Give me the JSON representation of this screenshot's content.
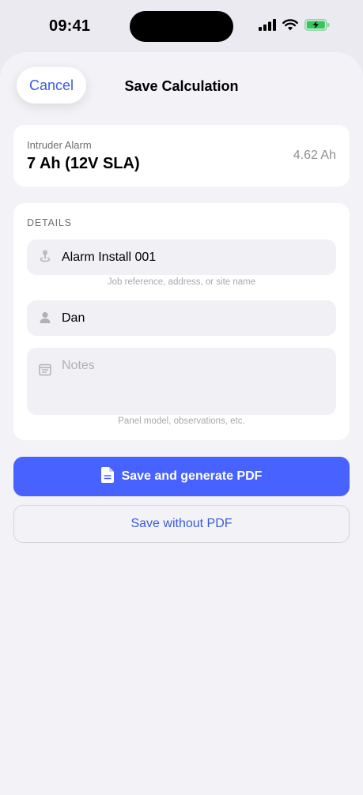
{
  "status_bar": {
    "time": "09:41",
    "battery_color": "#34c759"
  },
  "nav": {
    "cancel_label": "Cancel",
    "title": "Save Calculation"
  },
  "summary": {
    "label": "Intruder Alarm",
    "value": "7 Ah (12V SLA)",
    "amount": "4.62 Ah"
  },
  "details": {
    "header": "DETAILS",
    "site": {
      "value": "Alarm Install 001",
      "hint": "Job reference, address, or site name",
      "icon": "location-pin-icon"
    },
    "engineer": {
      "value": "Dan",
      "icon": "person-icon"
    },
    "notes": {
      "placeholder": "Notes",
      "hint": "Panel model, observations, etc.",
      "icon": "note-icon"
    }
  },
  "actions": {
    "primary_label": "Save and generate PDF",
    "primary_icon": "document-icon",
    "secondary_label": "Save without PDF"
  },
  "colors": {
    "accent": "#4762ff",
    "link": "#3b5bdb",
    "background": "#f2f2f7"
  }
}
